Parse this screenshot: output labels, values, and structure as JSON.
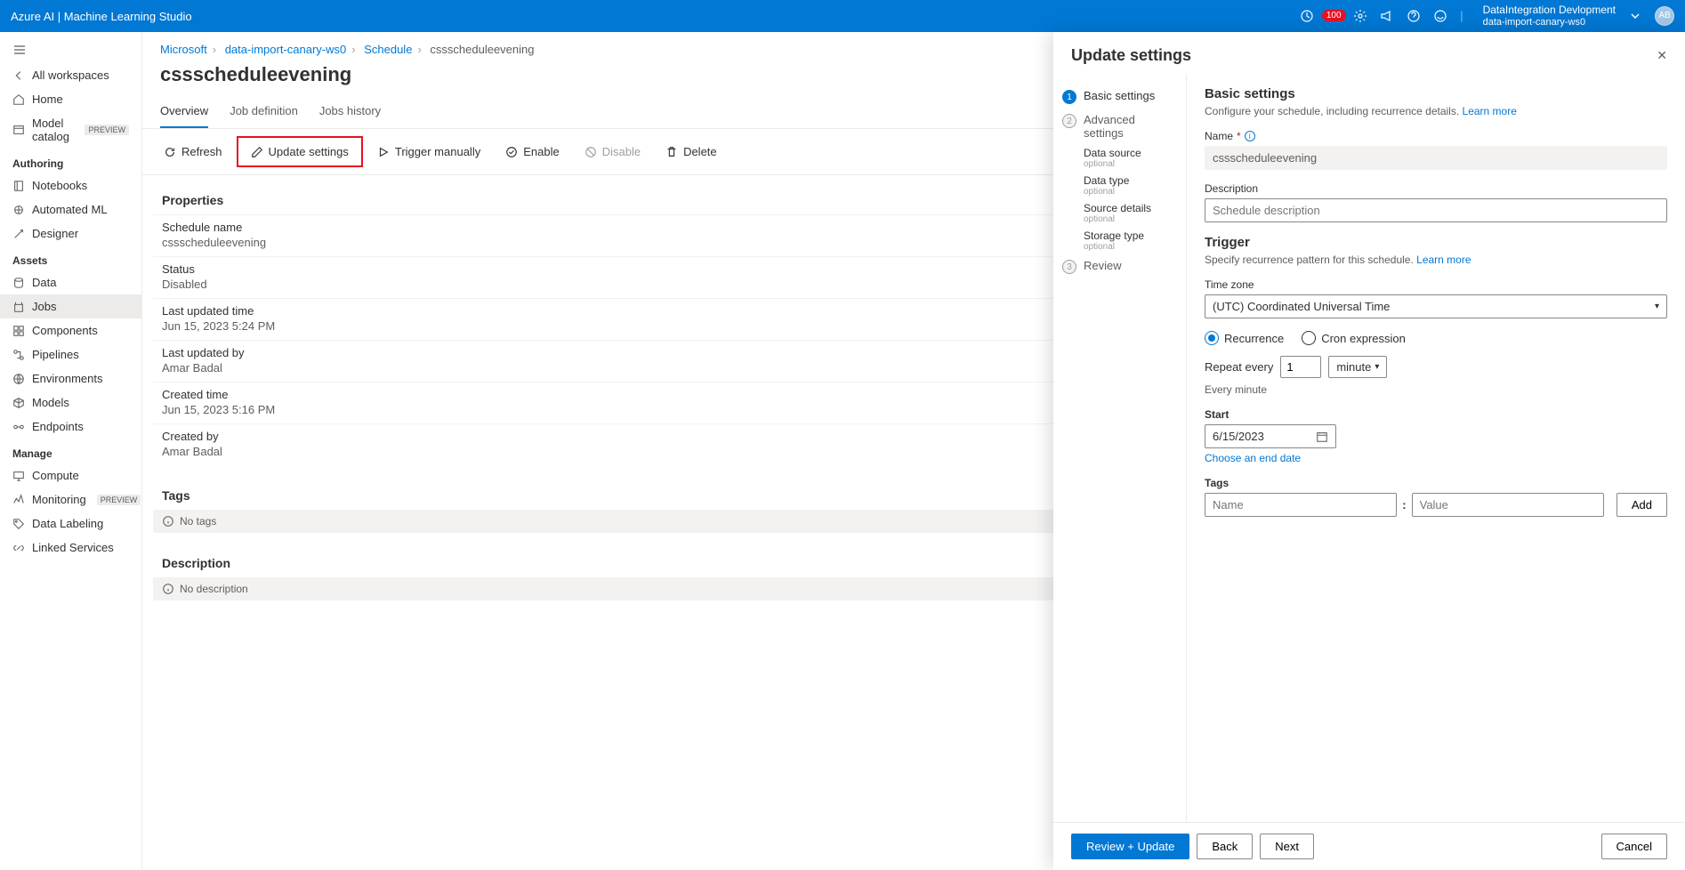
{
  "topbar": {
    "title": "Azure AI | Machine Learning Studio",
    "badge_count": "100",
    "account_name": "DataIntegration Devlopment",
    "account_sub": "data-import-canary-ws0",
    "avatar_initials": "AB"
  },
  "sidebar": {
    "back_label": "All workspaces",
    "items_top": [
      {
        "label": "Home"
      },
      {
        "label": "Model catalog",
        "preview": true
      }
    ],
    "section_authoring": "Authoring",
    "items_authoring": [
      {
        "label": "Notebooks"
      },
      {
        "label": "Automated ML"
      },
      {
        "label": "Designer"
      }
    ],
    "section_assets": "Assets",
    "items_assets": [
      {
        "label": "Data"
      },
      {
        "label": "Jobs"
      },
      {
        "label": "Components"
      },
      {
        "label": "Pipelines"
      },
      {
        "label": "Environments"
      },
      {
        "label": "Models"
      },
      {
        "label": "Endpoints"
      }
    ],
    "section_manage": "Manage",
    "items_manage": [
      {
        "label": "Compute"
      },
      {
        "label": "Monitoring",
        "preview": true
      },
      {
        "label": "Data Labeling"
      },
      {
        "label": "Linked Services"
      }
    ]
  },
  "breadcrumb": {
    "items": [
      "Microsoft",
      "data-import-canary-ws0",
      "Schedule",
      "cssscheduleevening"
    ]
  },
  "page_title": "cssscheduleevening",
  "tabs": [
    {
      "label": "Overview"
    },
    {
      "label": "Job definition"
    },
    {
      "label": "Jobs history"
    }
  ],
  "toolbar": {
    "refresh": "Refresh",
    "update": "Update settings",
    "trigger": "Trigger manually",
    "enable": "Enable",
    "disable": "Disable",
    "delete": "Delete"
  },
  "properties": {
    "header": "Properties",
    "schedule_name_label": "Schedule name",
    "schedule_name_value": "cssscheduleevening",
    "status_label": "Status",
    "status_value": "Disabled",
    "last_updated_label": "Last updated time",
    "last_updated_value": "Jun 15, 2023 5:24 PM",
    "last_updated_by_label": "Last updated by",
    "last_updated_by_value": "Amar Badal",
    "created_time_label": "Created time",
    "created_time_value": "Jun 15, 2023 5:16 PM",
    "created_by_label": "Created by",
    "created_by_value": "Amar Badal"
  },
  "tags_section": {
    "header": "Tags",
    "empty": "No tags"
  },
  "desc_section": {
    "header": "Description",
    "empty": "No description"
  },
  "panel": {
    "title": "Update settings",
    "steps": {
      "basic": "Basic settings",
      "advanced": "Advanced settings",
      "data_source": "Data source",
      "data_type": "Data type",
      "source_details": "Source details",
      "storage_type": "Storage type",
      "optional": "optional",
      "review": "Review"
    },
    "form": {
      "heading": "Basic settings",
      "sub": "Configure your schedule, including recurrence details.",
      "learn_more": "Learn more",
      "name_label": "Name",
      "name_value": "cssscheduleevening",
      "desc_label": "Description",
      "desc_placeholder": "Schedule description",
      "trigger_heading": "Trigger",
      "trigger_sub": "Specify recurrence pattern for this schedule.",
      "tz_label": "Time zone",
      "tz_value": "(UTC) Coordinated Universal Time",
      "radio_recurrence": "Recurrence",
      "radio_cron": "Cron expression",
      "repeat_label": "Repeat every",
      "repeat_value": "1",
      "repeat_unit": "minute",
      "summary": "Every minute",
      "start_label": "Start",
      "start_value": "6/15/2023",
      "choose_end": "Choose an end date",
      "tags_label": "Tags",
      "tag_name_pl": "Name",
      "tag_value_pl": "Value",
      "add": "Add"
    },
    "footer": {
      "review_update": "Review + Update",
      "back": "Back",
      "next": "Next",
      "cancel": "Cancel"
    }
  }
}
